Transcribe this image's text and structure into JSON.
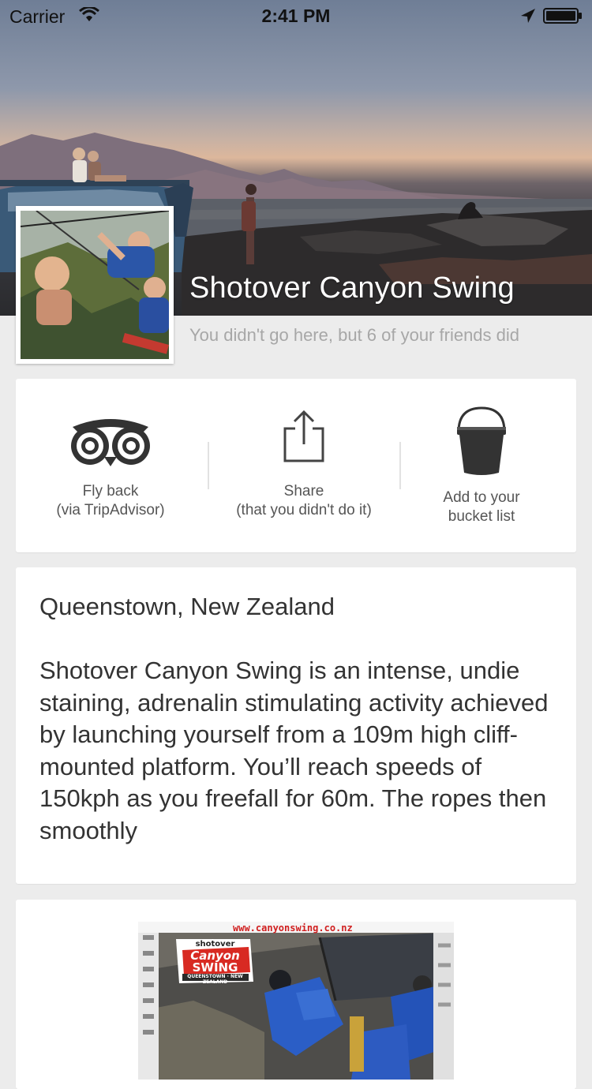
{
  "status_bar": {
    "carrier": "Carrier",
    "time": "2:41 PM"
  },
  "place": {
    "title": "Shotover Canyon Swing",
    "friends_note": "You didn't go here, but 6 of your friends did"
  },
  "actions": [
    {
      "line1": "Fly back",
      "line2": "(via TripAdvisor)",
      "icon": "tripadvisor-owl-icon"
    },
    {
      "line1": "Share",
      "line2": "(that you didn't do it)",
      "icon": "share-icon"
    },
    {
      "line1": "Add to your",
      "line2": "bucket list",
      "icon": "bucket-icon"
    }
  ],
  "details": {
    "location": "Queenstown, New Zealand",
    "description": "Shotover Canyon Swing is an intense, undie staining, adrenalin stimulating activity achieved by launching yourself from a 109m high cliff-mounted platform. You’ll reach speeds of 150kph as you freefall for 60m. The ropes then smoothly"
  },
  "poster": {
    "url": "www.canyonswing.co.nz",
    "logo_top": "shotover",
    "logo_mid1": "Canyon",
    "logo_mid2": "SWING",
    "logo_bottom": "QUEENSTOWN · NEW ZEALAND"
  },
  "colors": {
    "background": "#ececec",
    "card": "#ffffff",
    "icon_dark": "#333333",
    "muted_text": "#a7a7a7"
  }
}
